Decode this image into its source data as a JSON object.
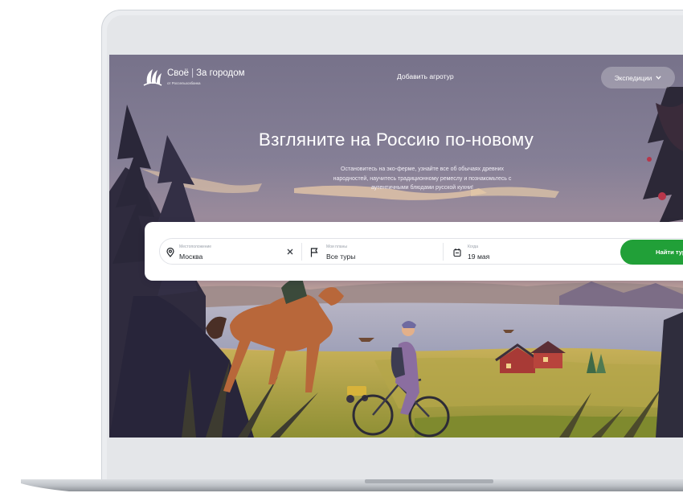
{
  "header": {
    "brand": "Своё",
    "brand_section": "За городом",
    "brand_sub": "от Россельхозбанка",
    "add_link": "Добавить агротур",
    "expeditions_label": "Экспедиции"
  },
  "hero": {
    "title": "Взгляните на Россию по-новому",
    "subtitle_lines": [
      "Остановитесь на эко-ферме, узнайте все об обычаях древних",
      "народностей, научитесь традиционному ремеслу и познакомьтесь с",
      "аутентичными блюдами русской кухни!"
    ]
  },
  "search": {
    "location": {
      "label": "Местоположение",
      "value": "Москва",
      "icon": "location-pin-icon"
    },
    "plans": {
      "label": "Мои планы",
      "value": "Все туры",
      "icon": "flag-icon"
    },
    "when": {
      "label": "Когда",
      "value": "19 мая",
      "icon": "calendar-icon"
    },
    "submit_label": "Найти туры"
  },
  "colors": {
    "accent": "#21a038",
    "sky_top": "#77728a",
    "sky_bottom": "#c9a58f",
    "grass": "#9a9a3a"
  }
}
